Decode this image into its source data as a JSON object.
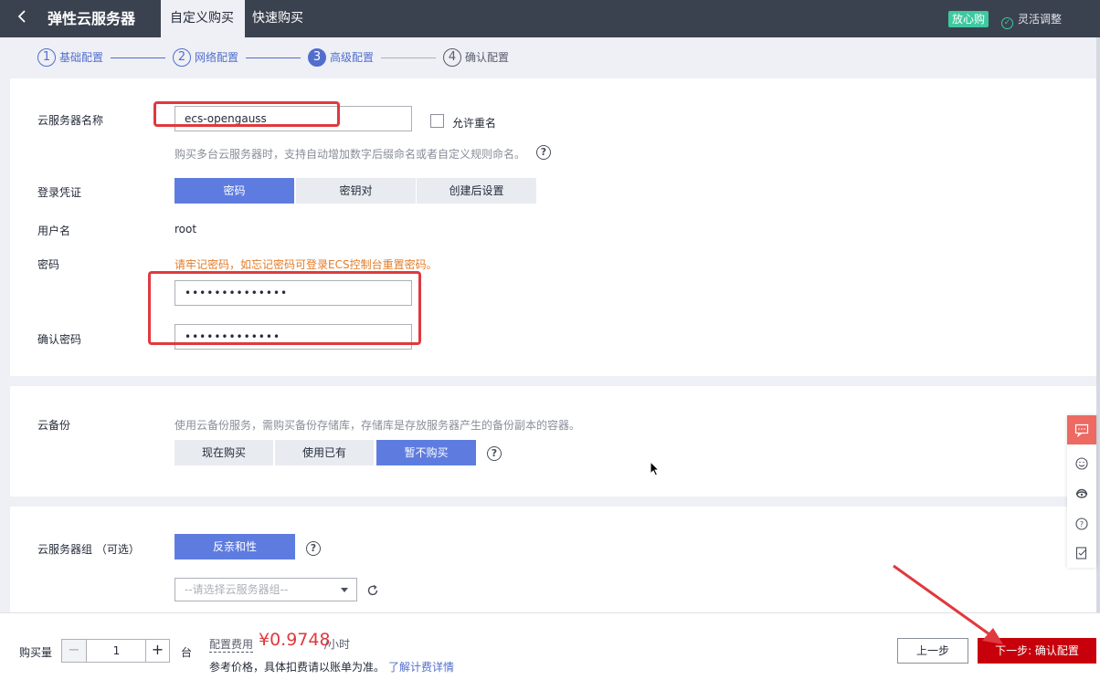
{
  "header": {
    "back_icon": "chevron-left-icon",
    "title": "弹性云服务器",
    "tabs": [
      {
        "label": "自定义购买",
        "active": true
      },
      {
        "label": "快速购买",
        "active": false
      }
    ],
    "badge": "放心购",
    "flex_adjust": "灵活调整",
    "accent_green": "#3ec99f"
  },
  "stepper": {
    "steps": [
      {
        "num": "1",
        "label": "基础配置"
      },
      {
        "num": "2",
        "label": "网络配置"
      },
      {
        "num": "3",
        "label": "高级配置"
      },
      {
        "num": "4",
        "label": "确认配置"
      }
    ],
    "current": 3
  },
  "config": {
    "name_label": "云服务器名称",
    "name_value": "ecs-opengauss",
    "allow_duplicate": "允许重名",
    "name_hint": "购买多台云服务器时，支持自动增加数字后缀命名或者自定义规则命名。",
    "login_label": "登录凭证",
    "login_options": [
      "密码",
      "密钥对",
      "创建后设置"
    ],
    "login_selected": "密码",
    "username_label": "用户名",
    "username_value": "root",
    "password_label": "密码",
    "password_warning": "请牢记密码，如忘记密码可登录ECS控制台重置密码。",
    "password_value": "••••••••••••••",
    "confirm_label": "确认密码",
    "confirm_value": "•••••••••••••"
  },
  "backup": {
    "label": "云备份",
    "hint": "使用云备份服务，需购买备份存储库，存储库是存放服务器产生的备份副本的容器。",
    "options": [
      "现在购买",
      "使用已有",
      "暂不购买"
    ],
    "selected": "暂不购买"
  },
  "group": {
    "label": "云服务器组 （可选）",
    "anti_affinity": "反亲和性",
    "select_placeholder": "--请选择云服务器组--",
    "refresh_icon": "refresh-icon"
  },
  "bottom": {
    "qty_label": "购买量",
    "qty_value": "1",
    "unit": "台",
    "fee_label": "配置费用",
    "price": "¥0.9748",
    "price_unit": "/小时",
    "ref_note": "参考价格，具体扣费请以账单为准。",
    "ref_link": "了解计费详情",
    "prev_button": "上一步",
    "next_button": "下一步: 确认配置",
    "brand_red": "#c7000b",
    "price_red": "#e0393e"
  },
  "float_bar": [
    "chat-icon",
    "smile-icon",
    "headset-icon",
    "help-icon",
    "edit-icon"
  ]
}
